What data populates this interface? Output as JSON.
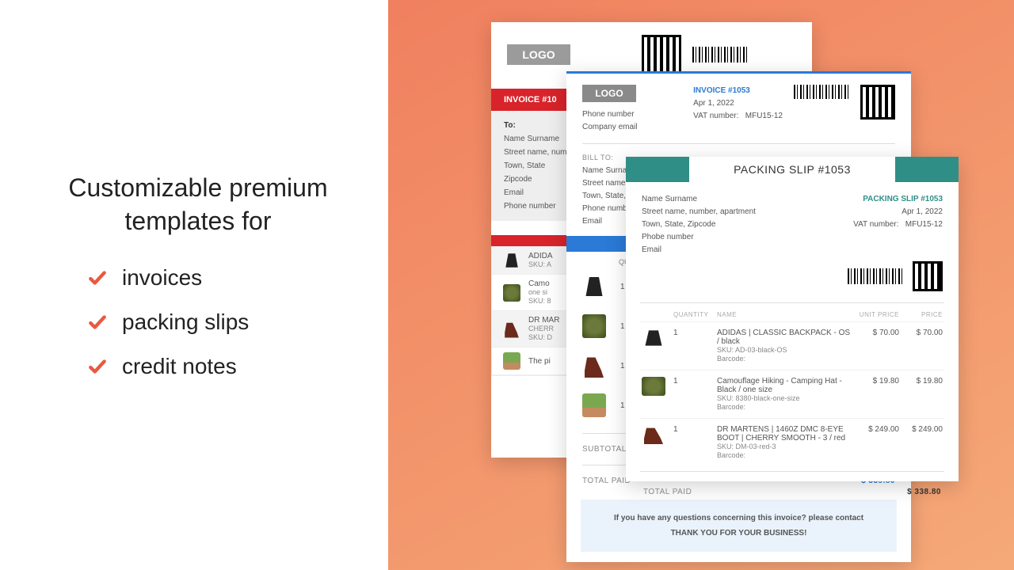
{
  "headline_l1": "Customizable premium",
  "headline_l2": "templates for",
  "bullets": [
    "invoices",
    "packing slips",
    "credit notes"
  ],
  "doc1": {
    "logo": "LOGO",
    "invoice_label": "INVOICE #10",
    "to_label": "To:",
    "name": "Name Surname",
    "street": "Street name, number, ap",
    "town": "Town, State",
    "zip": "Zipcode",
    "email": "Email",
    "phone": "Phone number",
    "r1a": "ADIDA",
    "r1b": "SKU: A",
    "r2a": "Camo",
    "r2b": "one si",
    "r2c": "SKU: 8",
    "r3a": "DR MAR",
    "r3b": "CHERR",
    "r3c": "SKU: D",
    "r4a": "The pi"
  },
  "doc2": {
    "logo": "LOGO",
    "phone": "Phone number",
    "email": "Company email",
    "invoice_no": "INVOICE #1053",
    "date": "Apr 1, 2022",
    "vat_label": "VAT number:",
    "vat": "MFU15-12",
    "bill_label": "BILL TO:",
    "name": "Name Surname",
    "street": "Street name, number",
    "town": "Town, State, Zipc",
    "phone2": "Phone number",
    "email2": "Email",
    "qcol": "QUAN",
    "subtotal_label": "SUBTOTAL",
    "paid_label": "TOTAL PAID",
    "paid_value": "$ 339.80",
    "footer1": "If you have any questions concerning this invoice? please contact",
    "footer2": "THANK YOU FOR YOUR BUSINESS!"
  },
  "doc3": {
    "title": "PACKING SLIP #1053",
    "slipno": "PACKING SLIP   #1053",
    "date": "Apr 1, 2022",
    "vat_label": "VAT number:",
    "vat": "MFU15-12",
    "name": "Name Surname",
    "street": "Street name, number, apartment",
    "town": "Town, State, Zipcode",
    "phone": "Phobe number",
    "email": "Email",
    "cols": {
      "qty": "QUANTITY",
      "name": "NAME",
      "unit": "UNIT PRICE",
      "price": "PRICE"
    },
    "items": [
      {
        "qty": "1",
        "name": "ADIDAS | CLASSIC BACKPACK - OS / black",
        "sku": "SKU: AD-03-black-OS",
        "barcode": "Barcode:",
        "unit": "$ 70.00",
        "price": "$ 70.00"
      },
      {
        "qty": "1",
        "name": "Camouflage Hiking - Camping Hat - Black / one size",
        "sku": "SKU: 8380-black-one-size",
        "barcode": "Barcode:",
        "unit": "$ 19.80",
        "price": "$ 19.80"
      },
      {
        "qty": "1",
        "name": "DR MARTENS | 1460Z DMC 8-EYE BOOT | CHERRY SMOOTH - 3 / red",
        "sku": "SKU: DM-03-red-3",
        "barcode": "Barcode:",
        "unit": "$ 249.00",
        "price": "$ 249.00"
      }
    ],
    "total_label": "TOTAL PAID",
    "total_value": "$ 338.80"
  }
}
